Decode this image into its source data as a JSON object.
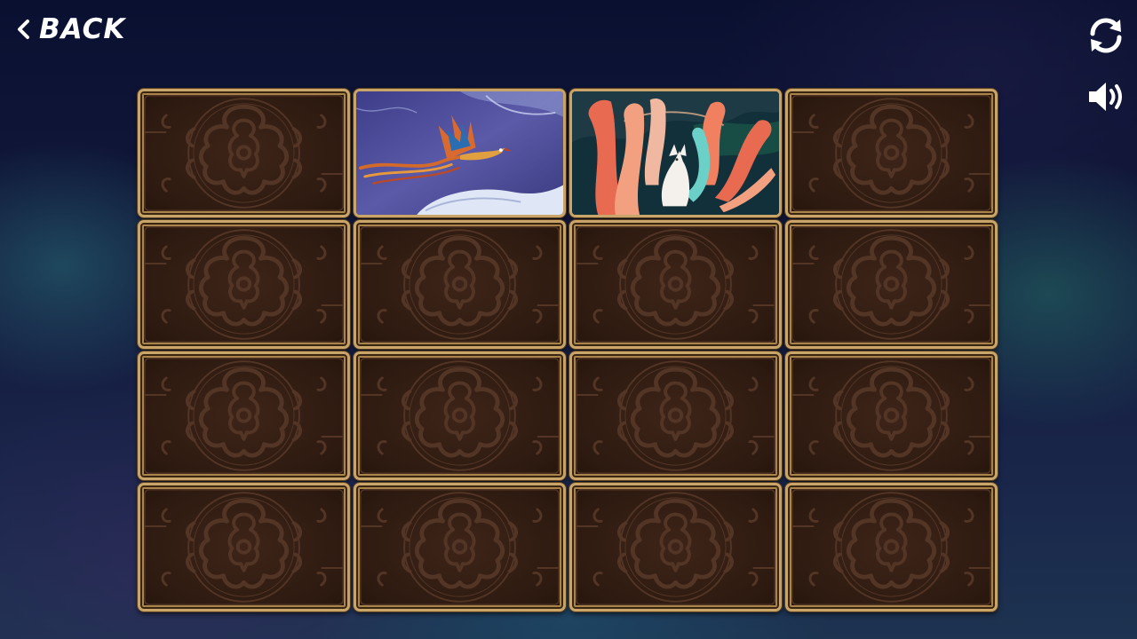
{
  "nav": {
    "back_label": "BACK",
    "back_icon": "chevron-left-icon",
    "restart_icon": "restart-icon",
    "sound_icon": "speaker-icon"
  },
  "colors": {
    "card_back": "#2d1a10",
    "card_pattern": "#533526",
    "card_frame": "#caa56a"
  },
  "board": {
    "rows": 4,
    "cols": 4,
    "cards": [
      {
        "state": "face-down"
      },
      {
        "state": "face-up",
        "image": "phoenix"
      },
      {
        "state": "face-up",
        "image": "nine-tailed-fox"
      },
      {
        "state": "face-down"
      },
      {
        "state": "face-down"
      },
      {
        "state": "face-down"
      },
      {
        "state": "face-down"
      },
      {
        "state": "face-down"
      },
      {
        "state": "face-down"
      },
      {
        "state": "face-down"
      },
      {
        "state": "face-down"
      },
      {
        "state": "face-down"
      },
      {
        "state": "face-down"
      },
      {
        "state": "face-down"
      },
      {
        "state": "face-down"
      },
      {
        "state": "face-down"
      }
    ]
  }
}
